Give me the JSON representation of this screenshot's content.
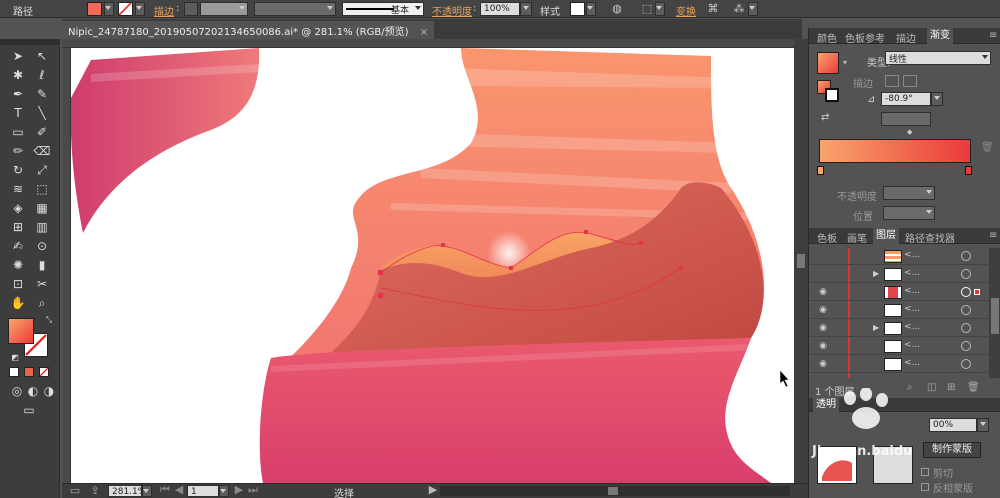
{
  "control_bar": {
    "object_type": "路径",
    "stroke_label": "描边",
    "stroke_value": "",
    "profile_label": "基本",
    "opacity_label": "不透明度",
    "opacity_value": "100%",
    "style_label": "样式",
    "transform_label": "变换",
    "fill_color": "#f26a5a"
  },
  "document": {
    "tab_title": "Nipic_24787180_20190507202134650086.ai* @ 281.1% (RGB/预览)",
    "close_glyph": "×"
  },
  "tools": [
    "selection-tool",
    "direct-selection-tool",
    "magic-wand-tool",
    "lasso-tool",
    "pen-tool",
    "curvature-tool",
    "type-tool",
    "line-tool",
    "rectangle-tool",
    "paintbrush-tool",
    "pencil-tool",
    "eraser-tool",
    "rotate-tool",
    "scale-tool",
    "width-tool",
    "free-transform-tool",
    "shape-builder-tool",
    "perspective-grid-tool",
    "mesh-tool",
    "gradient-tool",
    "eyedropper-tool",
    "blend-tool",
    "symbol-sprayer-tool",
    "column-graph-tool",
    "artboard-tool",
    "slice-tool",
    "hand-tool",
    "zoom-tool"
  ],
  "status_bar": {
    "zoom": "281.1%",
    "artboard": "1",
    "mode": "选择"
  },
  "gradient_panel": {
    "tabs": [
      "颜色",
      "色板参考",
      "描边",
      "渐变"
    ],
    "active_tab": "渐变",
    "type_label": "类型:",
    "type_value": "线性",
    "stroke_label": "描边",
    "angle_value": "-80.9°",
    "opacity_label": "不透明度",
    "position_label": "位置",
    "stop_left": "#f9a56b",
    "stop_right": "#ec3a3a"
  },
  "layers_panel": {
    "tabs": [
      "色板",
      "画笔",
      "图层",
      "路径查找器"
    ],
    "active_tab": "图层",
    "layer_count": "1 个图层",
    "rows": [
      {
        "name": "<...",
        "visible": false,
        "arrow": false,
        "thumb": "lines"
      },
      {
        "name": "<...",
        "visible": false,
        "arrow": true,
        "thumb": "plain"
      },
      {
        "name": "<...",
        "visible": true,
        "arrow": false,
        "thumb": "red"
      },
      {
        "name": "<...",
        "visible": true,
        "arrow": false,
        "thumb": "plain"
      },
      {
        "name": "<...",
        "visible": true,
        "arrow": true,
        "thumb": "plain"
      },
      {
        "name": "<...",
        "visible": true,
        "arrow": false,
        "thumb": "plain"
      },
      {
        "name": "<...",
        "visible": true,
        "arrow": false,
        "thumb": "plain"
      }
    ]
  },
  "transparency_panel": {
    "title": "透明",
    "opacity_value": "00%",
    "make_mask_button": "制作蒙版",
    "clip_label": "剪切",
    "invert_mask_label": "反相蒙版"
  },
  "watermark": {
    "text": "Jingyan.baidu"
  },
  "colors": {
    "coral_top": "#f8926a",
    "coral_mid": "#f47a6e",
    "pink_bottom": "#e0456a",
    "mountain_red": "#c9524c",
    "mountain_orange": "#f39a60"
  }
}
